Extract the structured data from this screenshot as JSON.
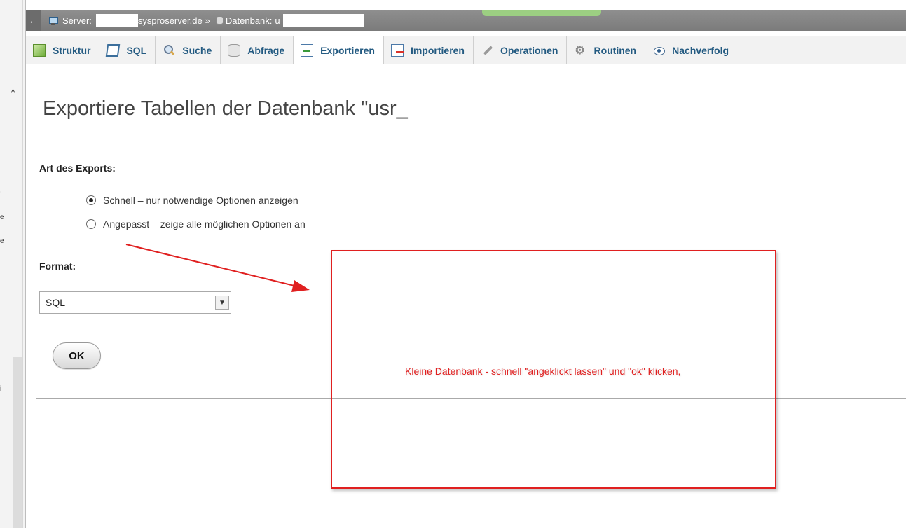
{
  "breadcrumb": {
    "back_symbol": "←",
    "server_label": "Server:",
    "server_host_suffix": "sysproserver.de",
    "separator": "»",
    "database_label": "Datenbank:",
    "database_name_prefix": "u"
  },
  "tabs": [
    {
      "id": "struktur",
      "label": "Struktur",
      "icon": "structure-icon"
    },
    {
      "id": "sql",
      "label": "SQL",
      "icon": "sql-icon"
    },
    {
      "id": "suche",
      "label": "Suche",
      "icon": "search-icon"
    },
    {
      "id": "abfrage",
      "label": "Abfrage",
      "icon": "query-icon"
    },
    {
      "id": "exportieren",
      "label": "Exportieren",
      "icon": "export-icon",
      "active": true
    },
    {
      "id": "importieren",
      "label": "Importieren",
      "icon": "import-icon"
    },
    {
      "id": "operationen",
      "label": "Operationen",
      "icon": "wrench-icon"
    },
    {
      "id": "routinen",
      "label": "Routinen",
      "icon": "routines-icon"
    },
    {
      "id": "nachverfolgung",
      "label": "Nachverfolg",
      "icon": "eye-icon"
    }
  ],
  "main": {
    "title": "Exportiere Tabellen der Datenbank \"usr_",
    "export_type_label": "Art des Exports:",
    "export_options": [
      {
        "label": "Schnell – nur notwendige Optionen anzeigen",
        "checked": true
      },
      {
        "label": "Angepasst – zeige alle möglichen Optionen an",
        "checked": false
      }
    ],
    "format_label": "Format:",
    "format_selected": "SQL",
    "ok_label": "OK"
  },
  "annotation": {
    "text": "Kleine Datenbank - schnell \"angeklickt lassen\" und \"ok\" klicken,",
    "color": "#e02020"
  },
  "colors": {
    "tab_text": "#235a81",
    "breadcrumb_bg": "#888888"
  }
}
